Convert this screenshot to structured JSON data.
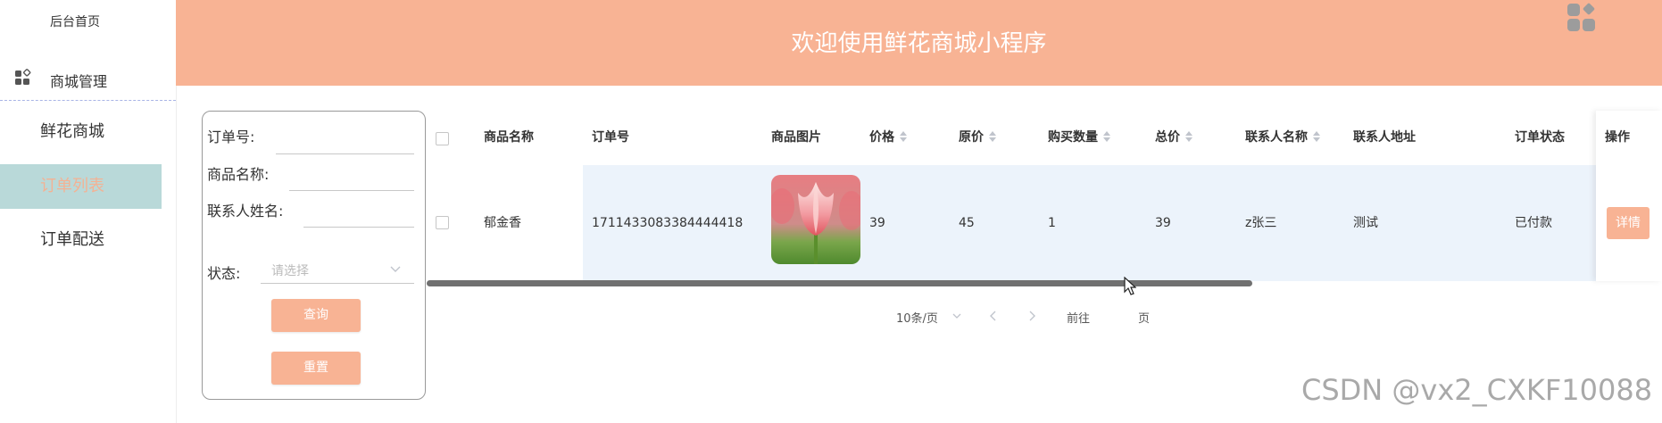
{
  "sidebar": {
    "home": "后台首页",
    "menu": {
      "icon": "grid-icon",
      "label": "商城管理"
    },
    "items": [
      {
        "label": "鲜花商城",
        "active": false
      },
      {
        "label": "订单列表",
        "active": true
      },
      {
        "label": "订单配送",
        "active": false
      }
    ]
  },
  "header": {
    "title": "欢迎使用鲜花商城小程序",
    "decor_icon": "grid-icon"
  },
  "search": {
    "order_no_label": "订单号:",
    "product_name_label": "商品名称:",
    "contact_name_label": "联系人姓名:",
    "status_label": "状态:",
    "status_placeholder": "请选择",
    "query_button": "查询",
    "reset_button": "重置"
  },
  "table": {
    "columns": [
      "商品名称",
      "订单号",
      "商品图片",
      "价格",
      "原价",
      "购买数量",
      "总价",
      "联系人名称",
      "联系人地址",
      "订单状态",
      "操作"
    ],
    "rows": [
      {
        "product_name": "郁金香",
        "order_no": "1711433083384444418",
        "image": "tulip-image",
        "price": "39",
        "original_price": "45",
        "quantity": "1",
        "total": "39",
        "contact_name": "z张三",
        "contact_address": "测试",
        "status": "已付款",
        "action": "详情"
      }
    ]
  },
  "pagination": {
    "page_size": "10条/页",
    "goto": "前往",
    "page": "页"
  },
  "watermark": "CSDN @vx2_CXKF10088",
  "colors": {
    "accent": "#f8b394",
    "active_bg": "#b9d9d9",
    "row_highlight": "#ecf3fb"
  }
}
